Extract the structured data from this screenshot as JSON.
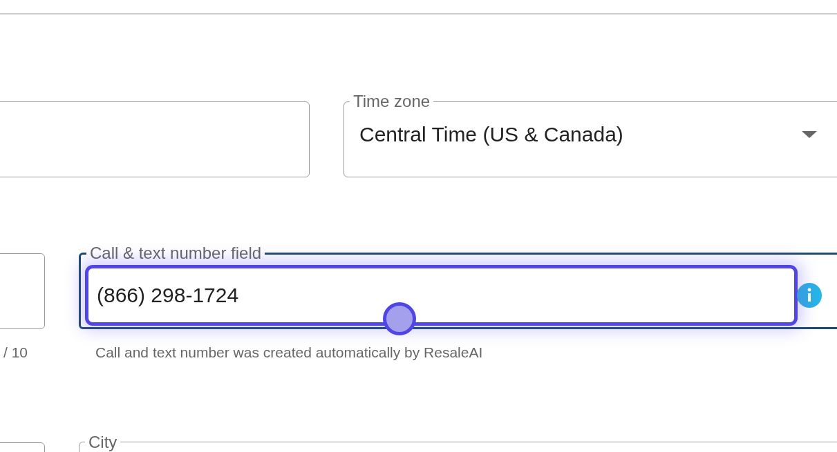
{
  "rows": [
    [
      {
        "kind": "input"
      },
      {
        "kind": "select",
        "label": "Time zone",
        "value": "Central Time (US & Canada)"
      }
    ],
    [
      {
        "kind": "input",
        "counter": "/ 10"
      },
      {
        "kind": "input",
        "label": "Call & text number field",
        "value": "(866) 298-1724",
        "helper": "Call and text number was created automatically by ResaleAI",
        "focused": true,
        "info": true
      }
    ],
    [
      {
        "kind": "input"
      },
      {
        "kind": "input",
        "label": "City"
      }
    ]
  ]
}
